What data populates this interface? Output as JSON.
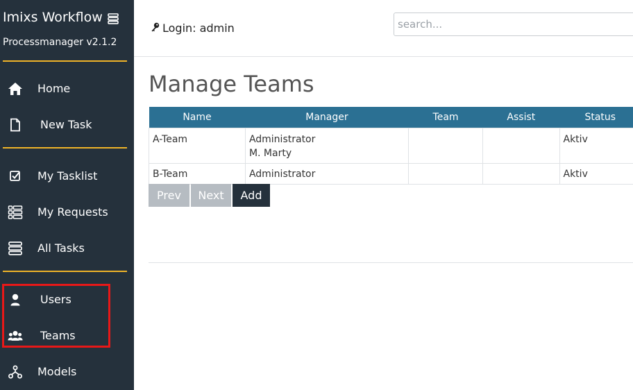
{
  "app": {
    "brand": "Imixs Workflow",
    "version": "Processmanager v2.1.2"
  },
  "sidebar": {
    "items": [
      {
        "label": "Home",
        "icon": "home-icon"
      },
      {
        "label": "New Task",
        "icon": "file-icon"
      },
      {
        "label": "My Tasklist",
        "icon": "check-square-icon"
      },
      {
        "label": "My Requests",
        "icon": "list-icon"
      },
      {
        "label": "All Tasks",
        "icon": "stack-icon"
      },
      {
        "label": "Users",
        "icon": "user-icon"
      },
      {
        "label": "Teams",
        "icon": "users-icon"
      },
      {
        "label": "Models",
        "icon": "sitemap-icon"
      }
    ]
  },
  "header": {
    "login_text": "Login: admin",
    "search_placeholder": "search..."
  },
  "main": {
    "title": "Manage Teams",
    "columns": [
      "Name",
      "Manager",
      "Team",
      "Assist",
      "Status"
    ],
    "rows": [
      {
        "name": "A-Team",
        "manager": [
          "Administrator",
          "M. Marty"
        ],
        "team": "",
        "assist": "",
        "status": "Aktiv"
      },
      {
        "name": "B-Team",
        "manager": [
          "Administrator"
        ],
        "team": "",
        "assist": "",
        "status": "Aktiv"
      }
    ],
    "buttons": {
      "prev": "Prev",
      "next": "Next",
      "add": "Add"
    }
  },
  "colors": {
    "sidebar_bg": "#25313c",
    "separator": "#f0b428",
    "table_header": "#2b7093",
    "highlight": "#e81818"
  }
}
